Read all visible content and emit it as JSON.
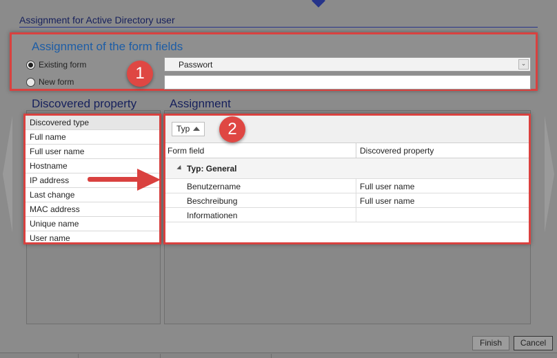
{
  "dialog": {
    "title": "Assignment for Active Directory user"
  },
  "form_fields": {
    "heading": "Assignment of the form fields",
    "options": [
      {
        "label": "Existing form",
        "checked": true
      },
      {
        "label": "New form",
        "checked": false
      }
    ],
    "existing_form_value": "Passwort",
    "new_form_value": ""
  },
  "badges": [
    "1",
    "2"
  ],
  "discovered": {
    "heading": "Discovered property",
    "items": [
      "Discovered type",
      "Full name",
      "Full user name",
      "Hostname",
      "IP address",
      "Last change",
      "MAC address",
      "Unique name",
      "User name"
    ]
  },
  "assignment": {
    "heading": "Assignment",
    "group_chip": "Typ",
    "columns": [
      "Form field",
      "Discovered property"
    ],
    "group_label": "Typ: General",
    "rows": [
      {
        "field": "Benutzername",
        "property": "Full user name"
      },
      {
        "field": "Beschreibung",
        "property": "Full user name"
      },
      {
        "field": "Informationen",
        "property": ""
      }
    ]
  },
  "buttons": {
    "finish": "Finish",
    "cancel": "Cancel"
  },
  "colors": {
    "highlight": "#d9413f",
    "title": "#16205c",
    "accent_heading": "#1d5da6"
  },
  "icons": [
    "chevron-down-icon",
    "sort-up-icon",
    "collapse-triangle-icon",
    "arrow-right-icon"
  ]
}
